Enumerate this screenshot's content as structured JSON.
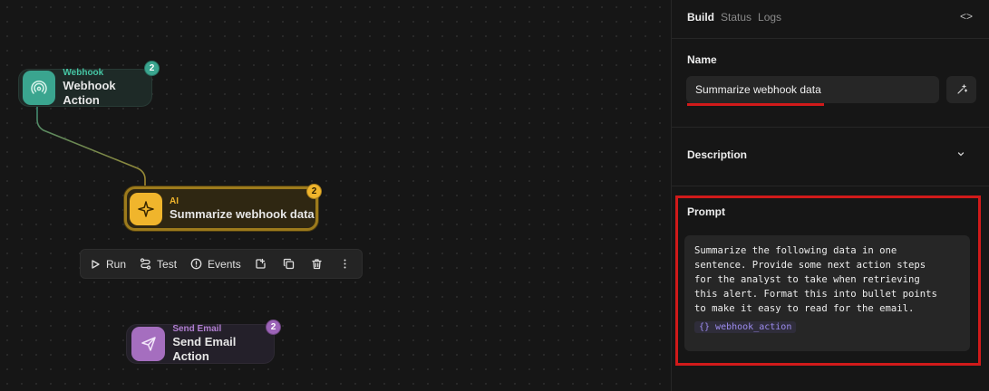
{
  "canvas": {
    "nodes": {
      "webhook": {
        "type": "Webhook",
        "title": "Webhook Action",
        "badge": "2",
        "icon": "webhook-icon",
        "color": "#3aa58f"
      },
      "ai": {
        "type": "AI",
        "title": "Summarize webhook data",
        "badge": "2",
        "icon": "sparkle-icon",
        "color": "#f0b52c"
      },
      "email": {
        "type": "Send Email",
        "title": "Send Email Action",
        "badge": "2",
        "icon": "send-icon",
        "color": "#a56ebf"
      }
    },
    "toolbar": {
      "run_label": "Run",
      "test_label": "Test",
      "events_label": "Events"
    }
  },
  "panel": {
    "tabs": [
      {
        "label": "Build",
        "active": true
      },
      {
        "label": "Status",
        "active": false
      },
      {
        "label": "Logs",
        "active": false
      }
    ],
    "code_toggle": "<>",
    "name_label": "Name",
    "name_value": "Summarize webhook data",
    "description_label": "Description",
    "prompt_label": "Prompt",
    "prompt_text": "Summarize the following data in one\nsentence. Provide some next action steps\nfor the analyst to take when retrieving\nthis alert. Format this into bullet points\nto make it easy to read for the email.",
    "prompt_variable": "{} webhook_action"
  },
  "colors": {
    "highlight_red": "#d11a1a",
    "ai_accent": "#f0b52c",
    "webhook_accent": "#3aa58f",
    "email_accent": "#a56ebf"
  }
}
